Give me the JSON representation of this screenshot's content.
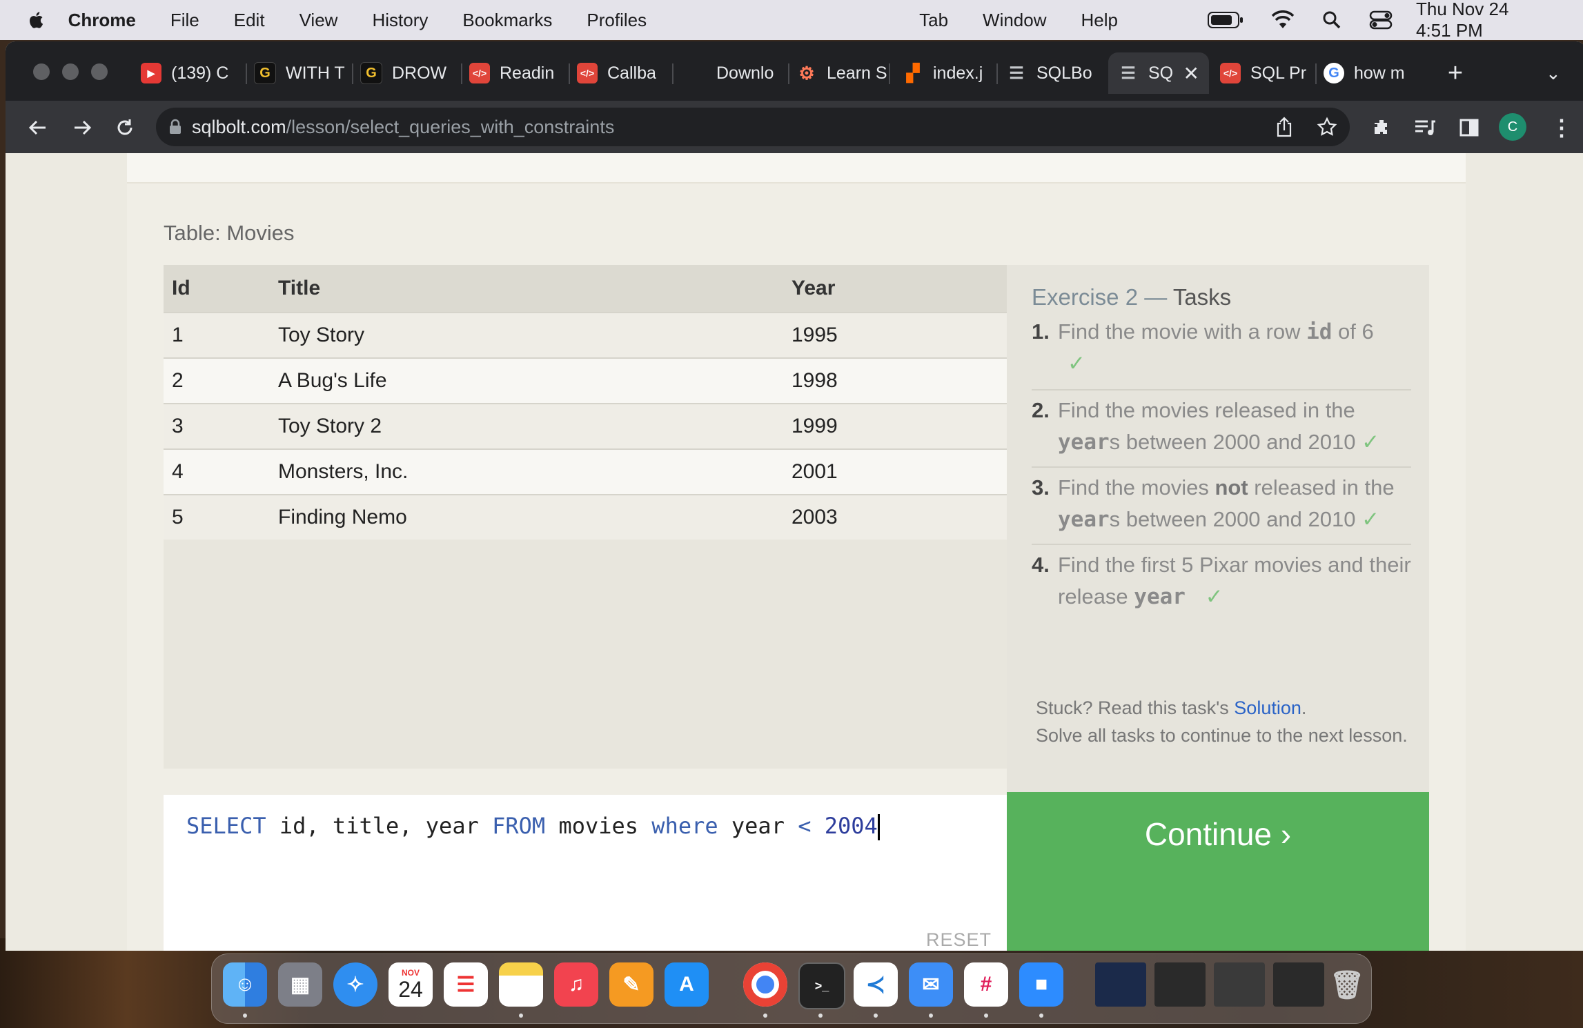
{
  "menubar": {
    "app": "Chrome",
    "items": [
      "File",
      "Edit",
      "View",
      "History",
      "Bookmarks",
      "Profiles"
    ],
    "right_items": [
      "Tab",
      "Window",
      "Help"
    ],
    "clock": "Thu Nov 24  4:51 PM"
  },
  "tabs": [
    {
      "label": "(139) C",
      "icon": "youtube-icon",
      "color": "#e53935"
    },
    {
      "label": "WITH T",
      "icon": "g-icon",
      "color": "#f2c02e"
    },
    {
      "label": "DROW",
      "icon": "g-icon",
      "color": "#f2c02e"
    },
    {
      "label": "Readin",
      "icon": "shield-icon",
      "color": "#e0453a"
    },
    {
      "label": "Callba",
      "icon": "shield-icon",
      "color": "#e0453a"
    },
    {
      "label": "Downlo",
      "icon": "none",
      "color": "#202124"
    },
    {
      "label": "Learn S",
      "icon": "hubspot-icon",
      "color": "#ff7a59"
    },
    {
      "label": "index.j",
      "icon": "orange-square-icon",
      "color": "#ff6a00"
    },
    {
      "label": "SQLBo",
      "icon": "database-icon",
      "color": "#9aa0a6"
    },
    {
      "label": "SQ",
      "icon": "database-icon",
      "color": "#9aa0a6",
      "active": true
    },
    {
      "label": "SQL Pr",
      "icon": "shield-icon",
      "color": "#e0453a"
    },
    {
      "label": "how m",
      "icon": "google-icon",
      "color": "#ffffff"
    }
  ],
  "omnibox": {
    "host": "sqlbolt.com",
    "path": "/lesson/select_queries_with_constraints"
  },
  "profile_initial": "C",
  "table": {
    "caption": "Table: Movies",
    "headers": [
      "Id",
      "Title",
      "Year"
    ],
    "rows": [
      [
        "1",
        "Toy Story",
        "1995"
      ],
      [
        "2",
        "A Bug's Life",
        "1998"
      ],
      [
        "3",
        "Toy Story 2",
        "1999"
      ],
      [
        "4",
        "Monsters, Inc.",
        "2001"
      ],
      [
        "5",
        "Finding Nemo",
        "2003"
      ]
    ]
  },
  "editor": {
    "query_parts": [
      "SELECT",
      " id, title, year ",
      "FROM",
      " movies ",
      "where",
      " year ",
      "<",
      " ",
      "2004"
    ],
    "reset_label": "RESET"
  },
  "tasks": {
    "heading_prefix": "Exercise 2 —",
    "heading_bold": "Tasks",
    "items": [
      {
        "num": "1.",
        "before": "Find the movie with a row ",
        "code": "id",
        "after": " of 6",
        "check": "✓"
      },
      {
        "num": "2.",
        "before": "Find the movies released in the ",
        "code": "year",
        "after": "s between 2000 and 2010",
        "check": "✓"
      },
      {
        "num": "3.",
        "before": "Find the movies ",
        "bold": "not",
        "before2": " released in the ",
        "code": "year",
        "after": "s between 2000 and 2010",
        "check": "✓"
      },
      {
        "num": "4.",
        "before": "Find the first 5 Pixar movies and their release ",
        "code": "year",
        "after": "",
        "check": "✓"
      }
    ]
  },
  "help": {
    "stuck_prefix": "Stuck? Read this task's ",
    "solution_link": "Solution",
    "stuck_suffix": ".",
    "line2": "Solve all tasks to continue to the next lesson."
  },
  "continue_label": "Continue ›",
  "dock": {
    "calendar_month": "NOV",
    "calendar_day": "24",
    "apps": [
      "finder-icon",
      "launchpad-icon",
      "safari-icon",
      "calendar-icon",
      "reminders-icon",
      "notes-icon",
      "music-icon",
      "pages-icon",
      "appstore-icon",
      "chrome-icon",
      "terminal-icon",
      "vscode-icon",
      "mail-icon",
      "slack-icon",
      "zoom-icon"
    ]
  }
}
